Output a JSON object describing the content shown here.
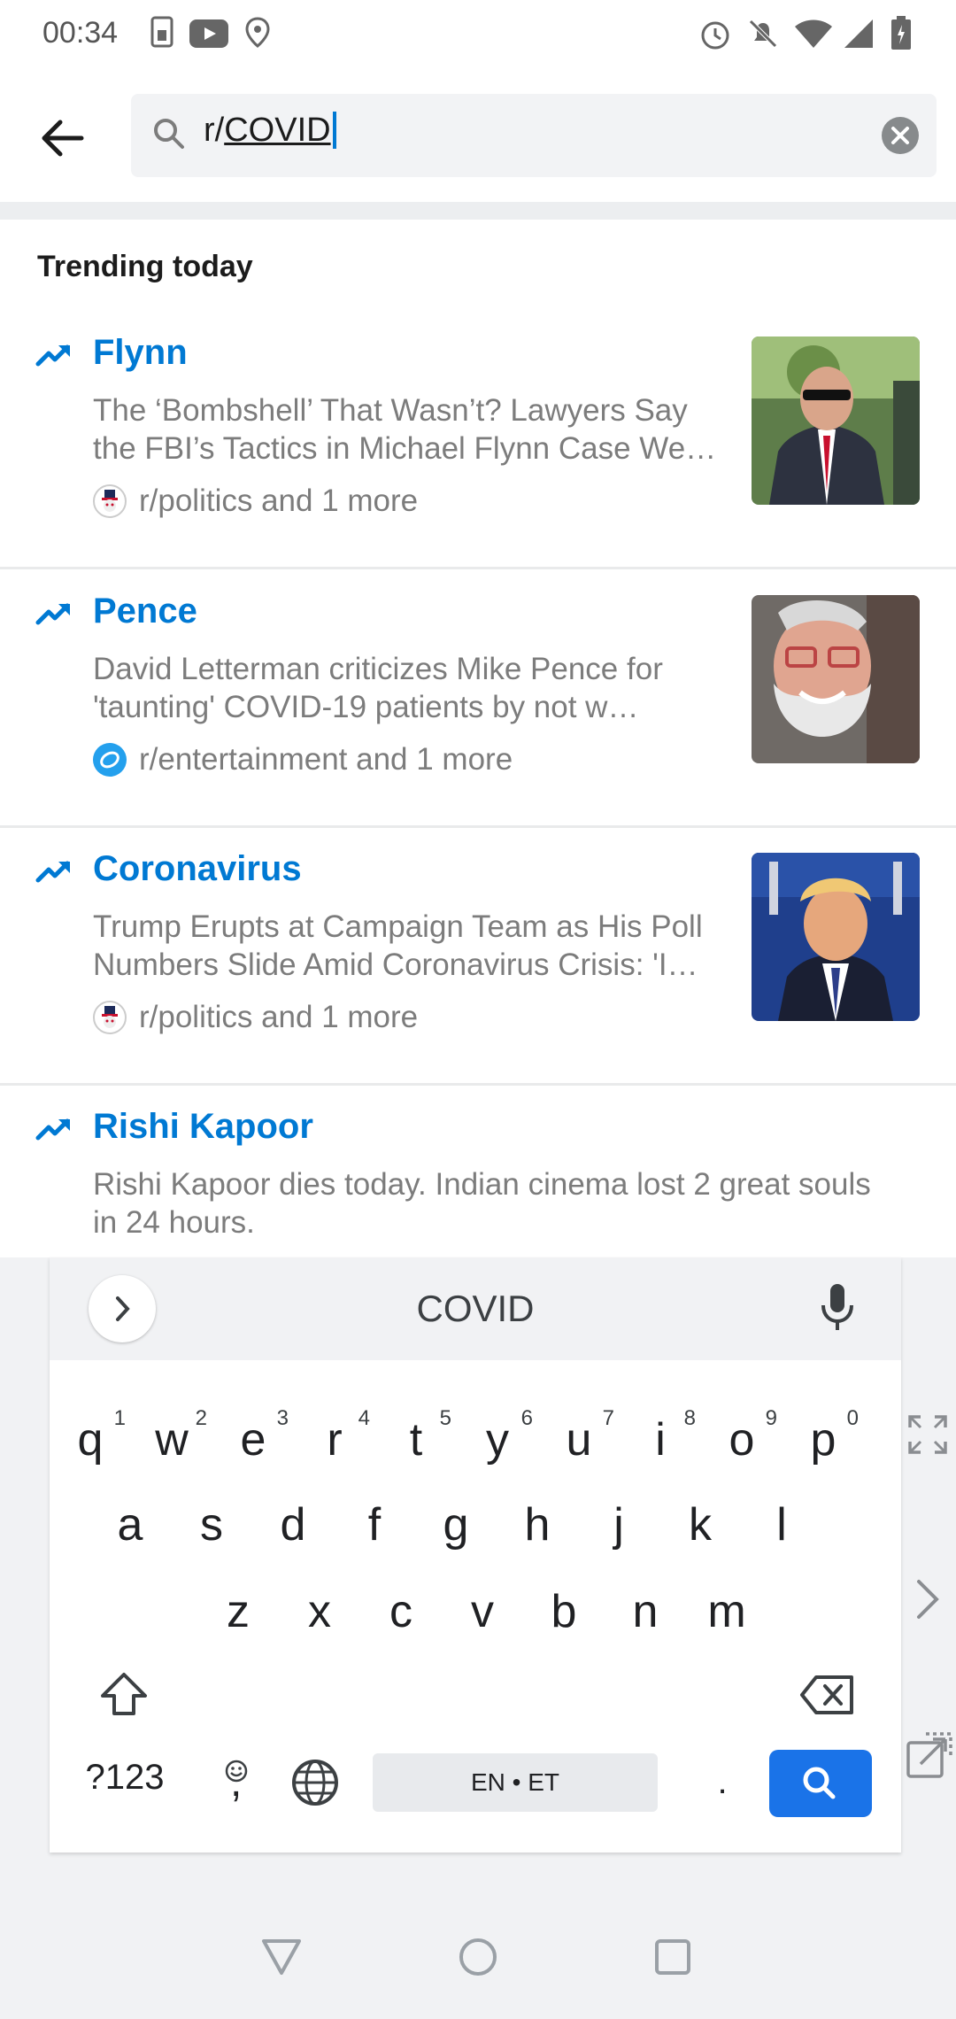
{
  "status_bar": {
    "time": "00:34",
    "icons": [
      "sim-icon",
      "youtube-icon",
      "location-icon",
      "alarm-icon",
      "mute-icon",
      "wifi-icon",
      "signal-icon",
      "battery-icon"
    ]
  },
  "search": {
    "prefix": "r/",
    "typed": "COVID",
    "icon": "search-icon",
    "clear_icon": "clear-icon"
  },
  "trending": {
    "heading": "Trending today",
    "items": [
      {
        "title": "Flynn",
        "description": "The ‘Bombshell’ That Wasn’t? Lawyers Say the FBI’s Tactics in Michael Flynn Case We…",
        "source": "r/politics and 1 more",
        "source_icon": "politics-avatar-icon"
      },
      {
        "title": "Pence",
        "description": "David Letterman criticizes Mike Pence for 'taunting' COVID-19 patients by not w…",
        "source": "r/entertainment and 1 more",
        "source_icon": "entertainment-avatar-icon"
      },
      {
        "title": "Coronavirus",
        "description": "Trump Erupts at Campaign Team as His Poll Numbers Slide Amid Coronavirus Crisis: 'I…",
        "source": "r/politics and 1 more",
        "source_icon": "politics-avatar-icon"
      },
      {
        "title": "Rishi Kapoor",
        "description": "Rishi Kapoor dies today. Indian cinema lost 2 great souls in 24 hours."
      }
    ]
  },
  "keyboard": {
    "suggestion": "COVID",
    "row1": [
      "q",
      "w",
      "e",
      "r",
      "t",
      "y",
      "u",
      "i",
      "o",
      "p"
    ],
    "row1_digits": [
      "1",
      "2",
      "3",
      "4",
      "5",
      "6",
      "7",
      "8",
      "9",
      "0"
    ],
    "row2": [
      "a",
      "s",
      "d",
      "f",
      "g",
      "h",
      "j",
      "k",
      "l"
    ],
    "row3": [
      "z",
      "x",
      "c",
      "v",
      "b",
      "n",
      "m"
    ],
    "symbols_label": "?123",
    "emoji_comma": ",",
    "space_label": "EN • ET",
    "period": ".",
    "colors": {
      "enter": "#1a73e8",
      "accent": "#0079d3"
    }
  }
}
